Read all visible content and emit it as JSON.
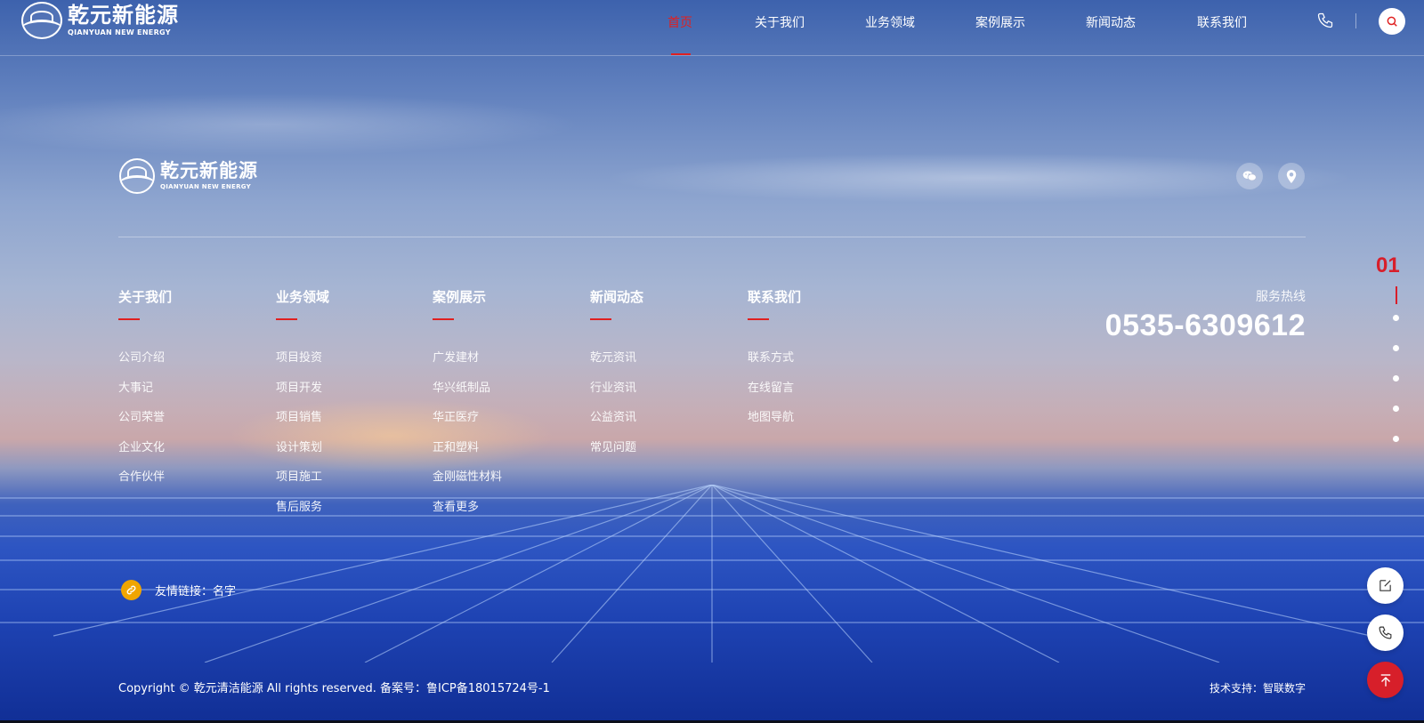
{
  "header": {
    "logo": {
      "cn": "乾元新能源",
      "en": "QIANYUAN NEW ENERGY"
    },
    "nav": [
      {
        "label": "首页",
        "active": true
      },
      {
        "label": "关于我们",
        "active": false
      },
      {
        "label": "业务领域",
        "active": false
      },
      {
        "label": "案例展示",
        "active": false
      },
      {
        "label": "新闻动态",
        "active": false
      },
      {
        "label": "联系我们",
        "active": false
      }
    ],
    "icons": {
      "phone": "phone-icon",
      "search": "search-icon"
    }
  },
  "footer": {
    "logo": {
      "cn": "乾元新能源",
      "en": "QIANYUAN NEW ENERGY"
    },
    "social": [
      "wechat-icon",
      "location-pin-icon"
    ],
    "columns": [
      {
        "title": "关于我们",
        "links": [
          "公司介绍",
          "大事记",
          "公司荣誉",
          "企业文化",
          "合作伙伴"
        ]
      },
      {
        "title": "业务领域",
        "links": [
          "项目投资",
          "项目开发",
          "项目销售",
          "设计策划",
          "项目施工",
          "售后服务"
        ]
      },
      {
        "title": "案例展示",
        "links": [
          "广发建材",
          "华兴纸制品",
          "华正医疗",
          "正和塑料",
          "金刚磁性材料",
          "查看更多"
        ]
      },
      {
        "title": "新闻动态",
        "links": [
          "乾元资讯",
          "行业资讯",
          "公益资讯",
          "常见问题"
        ]
      },
      {
        "title": "联系我们",
        "links": [
          "联系方式",
          "在线留言",
          "地图导航"
        ]
      }
    ],
    "hotline": {
      "label": "服务热线",
      "number": "0535-6309612"
    },
    "friend_links": "友情链接：名字",
    "copyright": "Copyright © 乾元清洁能源  All rights reserved.    备案号：鲁ICP备18015724号-1",
    "tech_support": "技术支持：智联数字"
  },
  "pager": {
    "current": "01",
    "dots": 5
  },
  "float_buttons": [
    "edit-icon",
    "phone-icon",
    "back-to-top-icon"
  ],
  "colors": {
    "accent": "#e02020",
    "link_icon_bg": "#f0a500"
  }
}
